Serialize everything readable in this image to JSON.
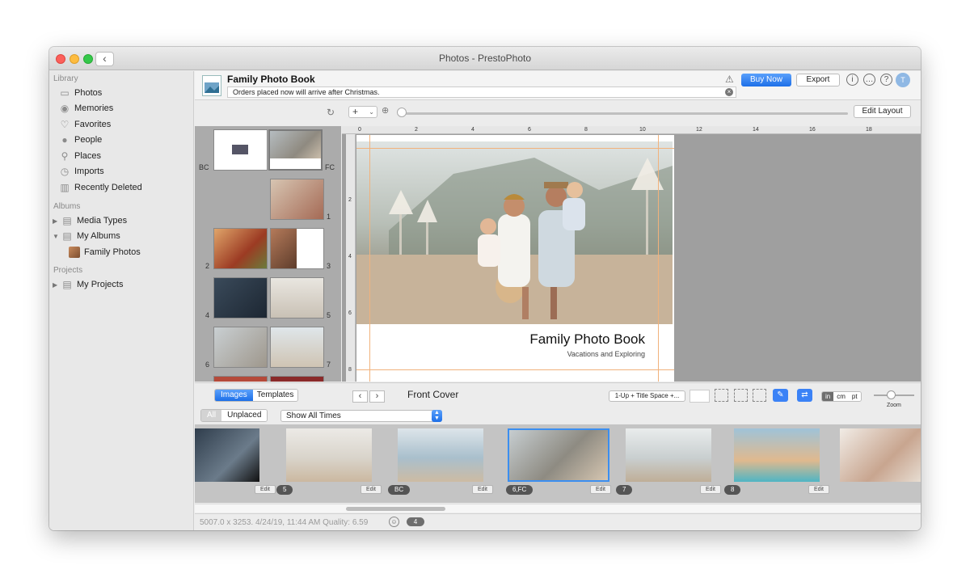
{
  "window": {
    "title": "Photos - PrestoPhoto"
  },
  "sidebar": {
    "library_header": "Library",
    "library": [
      {
        "label": "Photos",
        "icon": "photos-icon"
      },
      {
        "label": "Memories",
        "icon": "memories-icon"
      },
      {
        "label": "Favorites",
        "icon": "heart-icon"
      },
      {
        "label": "People",
        "icon": "person-icon"
      },
      {
        "label": "Places",
        "icon": "pin-icon"
      },
      {
        "label": "Imports",
        "icon": "clock-icon"
      },
      {
        "label": "Recently Deleted",
        "icon": "trash-icon"
      }
    ],
    "albums_header": "Albums",
    "albums": [
      {
        "label": "Media Types"
      },
      {
        "label": "My Albums"
      },
      {
        "label": "Family Photos"
      }
    ],
    "projects_header": "Projects",
    "projects": [
      {
        "label": "My Projects"
      }
    ]
  },
  "header": {
    "book_title": "Family Photo Book",
    "notice": "Orders placed now will arrive after Christmas.",
    "buy_now": "Buy Now",
    "export": "Export",
    "avatar_initial": "T"
  },
  "toolbar": {
    "add_label": "+",
    "edit_layout": "Edit Layout"
  },
  "pages_panel": {
    "labels": [
      "BC",
      "FC",
      "1",
      "2",
      "3",
      "4",
      "5",
      "6",
      "7"
    ]
  },
  "ruler": {
    "h_marks": [
      "0",
      "2",
      "4",
      "6",
      "8",
      "10",
      "12",
      "14",
      "16",
      "18"
    ],
    "v_marks": [
      "2",
      "4",
      "6",
      "8"
    ]
  },
  "cover": {
    "title": "Family Photo Book",
    "subtitle": "Vacations and Exploring"
  },
  "bottom": {
    "tab_images": "Images",
    "tab_templates": "Templates",
    "current_page": "Front Cover",
    "layout": "1-Up + Title Space +...",
    "units": [
      "in",
      "cm",
      "pt"
    ],
    "zoom_label": "Zoom",
    "filter_all": "All",
    "filter_unplaced": "Unplaced",
    "time_filter": "Show All Times"
  },
  "strip": [
    {
      "badge": "",
      "edit": "Edit"
    },
    {
      "badge": "5",
      "edit": "Edit"
    },
    {
      "badge": "BC",
      "edit": "Edit"
    },
    {
      "badge": "6,FC",
      "edit": "Edit"
    },
    {
      "badge": "7",
      "edit": "Edit"
    },
    {
      "badge": "8",
      "edit": "Edit"
    },
    {
      "badge": "",
      "edit": ""
    }
  ],
  "status": {
    "info": "5007.0 x 3253.  4/24/19, 11:44 AM    Quality: 6.59",
    "count": "4"
  },
  "colors": {
    "accent": "#1d6fe8",
    "guide": "#f1b27c"
  }
}
